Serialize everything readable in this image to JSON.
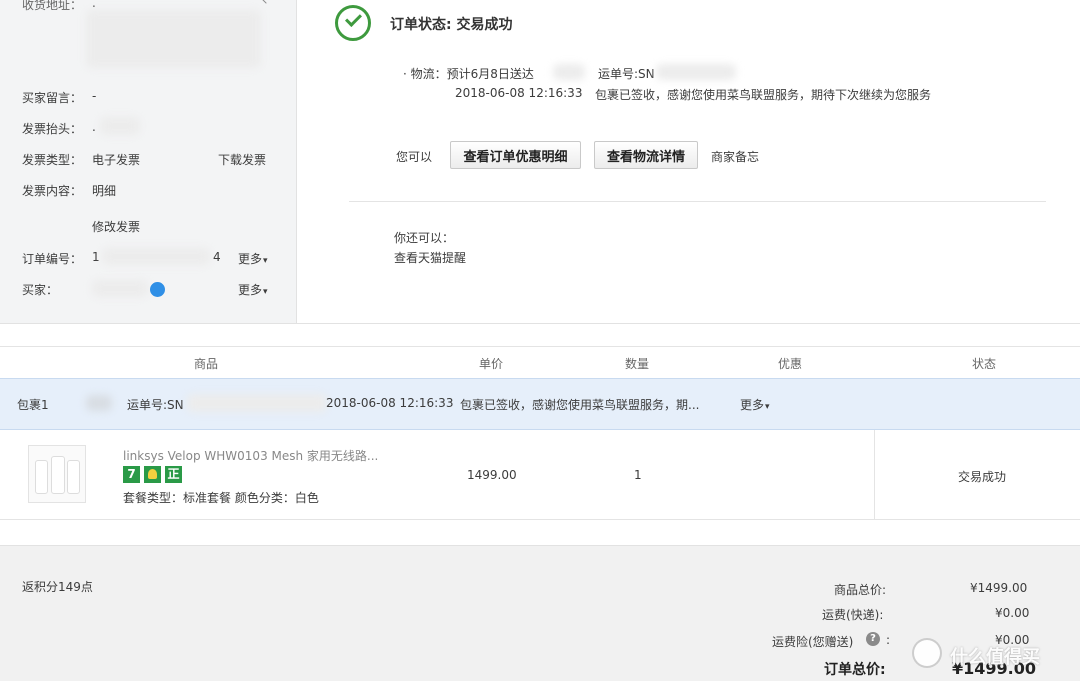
{
  "left_panel": {
    "address_label": "收货地址：",
    "address_value": ".",
    "message_label": "买家留言：",
    "message_value": "-",
    "invoice_title_label": "发票抬头：",
    "invoice_title_value": ".",
    "invoice_type_label": "发票类型：",
    "invoice_type_value": "电子发票",
    "download_invoice": "下载发票",
    "invoice_content_label": "发票内容：",
    "invoice_content_value": "明细",
    "modify_invoice": "修改发票",
    "order_no_label": "订单编号：",
    "order_no_value": "1",
    "order_no_tail": "4",
    "more": "更多",
    "buyer_label": "买家：",
    "buyer_more": "更多"
  },
  "status": {
    "title": "订单状态: 交易成功",
    "logistics_label": "· 物流：预计6月8日送达",
    "tracking_label": "运单号:SN",
    "timestamp": "2018-06-08 12:16:33",
    "delivery_message": "包裹已签收，感谢您使用菜鸟联盟服务，期待下次继续为您服务",
    "you_can": "您可以",
    "view_discount_button": "查看订单优惠明细",
    "view_logistics_button": "查看物流详情",
    "merchant_note": "商家备忘",
    "you_also_can": "你还可以：",
    "view_tmall_reminder": "查看天猫提醒"
  },
  "table": {
    "headers": [
      "商品",
      "单价",
      "数量",
      "优惠",
      "状态"
    ],
    "package": {
      "label": "包裹1",
      "tracking": "运单号:SN",
      "timestamp": "2018-06-08 12:16:33",
      "message": "包裹已签收，感谢您使用菜鸟联盟服务，期...",
      "more": "更多"
    },
    "item": {
      "name": "linksys Velop WHW0103 Mesh 家用无线路...",
      "badges": [
        "7",
        "",
        "正"
      ],
      "spec": "套餐类型：标准套餐  颜色分类：白色",
      "price": "1499.00",
      "quantity": "1",
      "status": "交易成功"
    }
  },
  "summary": {
    "points": "返积分149点",
    "goods_total_label": "商品总价:",
    "goods_total_value": "¥1499.00",
    "shipping_label": "运费(快递):",
    "shipping_value": "¥0.00",
    "insurance_label": "运费险(您赠送)",
    "insurance_value": "¥0.00",
    "order_total_label": "订单总价:",
    "order_total_value": "¥1499.00"
  },
  "watermark": "什么值得买",
  "colors": {
    "accent_blue": "#2a5ea8",
    "success_green": "#3e9a3e",
    "orange": "#e0600a",
    "package_row_bg": "#e6effa"
  }
}
